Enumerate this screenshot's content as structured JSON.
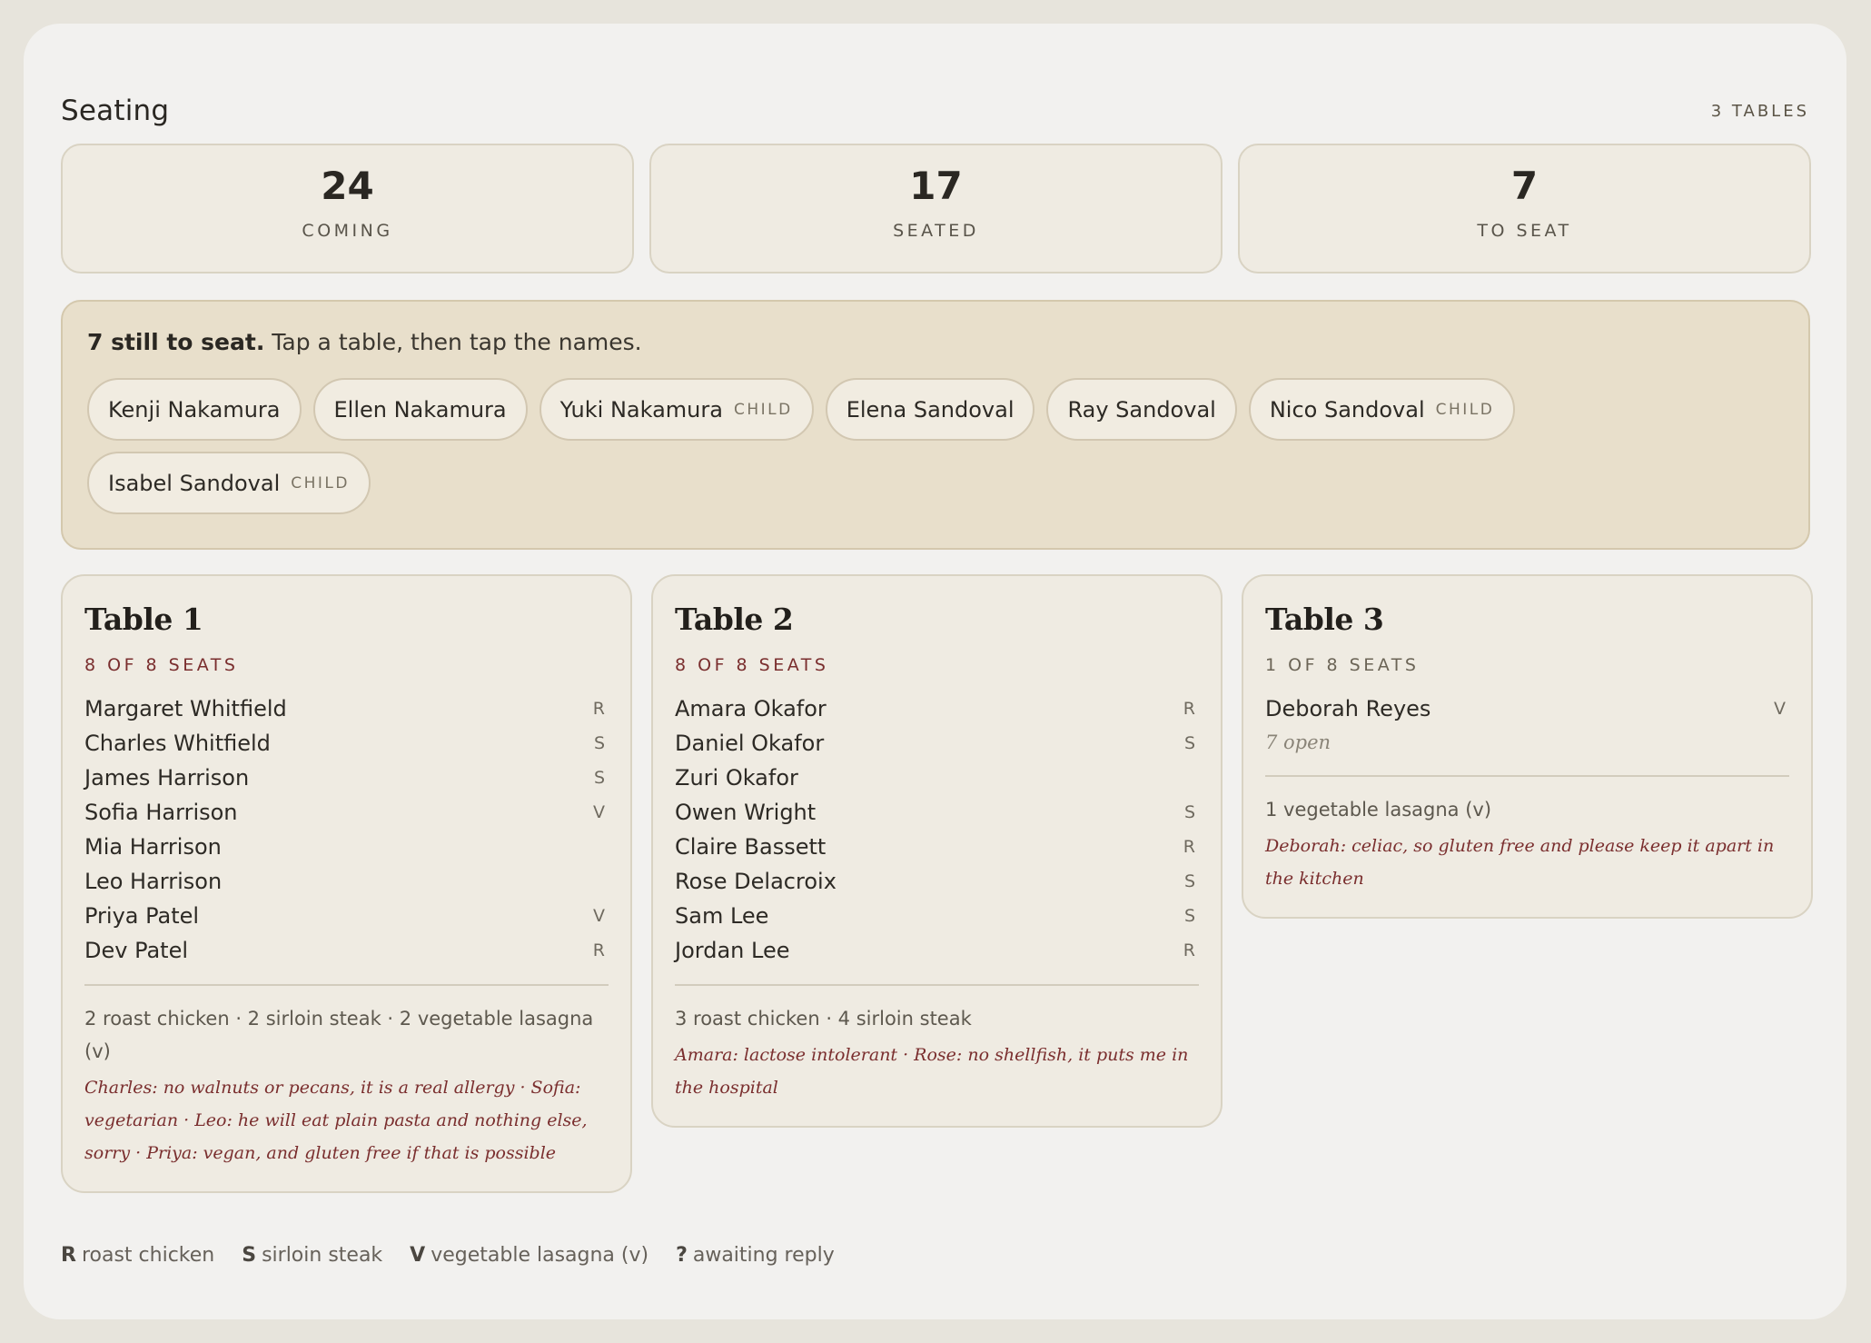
{
  "header": {
    "title": "Seating",
    "tables_count": "3 TABLES"
  },
  "stats": [
    {
      "value": "24",
      "label": "COMING"
    },
    {
      "value": "17",
      "label": "SEATED"
    },
    {
      "value": "7",
      "label": "TO SEAT"
    }
  ],
  "pending": {
    "bold": "7 still to seat.",
    "instruction": "Tap a table, then tap the names.",
    "guests": [
      {
        "name": "Kenji Nakamura",
        "tag": ""
      },
      {
        "name": "Ellen Nakamura",
        "tag": ""
      },
      {
        "name": "Yuki Nakamura",
        "tag": "CHILD"
      },
      {
        "name": "Elena Sandoval",
        "tag": ""
      },
      {
        "name": "Ray Sandoval",
        "tag": ""
      },
      {
        "name": "Nico Sandoval",
        "tag": "CHILD"
      },
      {
        "name": "Isabel Sandoval",
        "tag": "CHILD"
      }
    ]
  },
  "tables": [
    {
      "name": "Table 1",
      "seats": "8 OF 8 SEATS",
      "guests": [
        {
          "name": "Margaret Whitfield",
          "meal": "R"
        },
        {
          "name": "Charles Whitfield",
          "meal": "S"
        },
        {
          "name": "James Harrison",
          "meal": "S"
        },
        {
          "name": "Sofia Harrison",
          "meal": "V"
        },
        {
          "name": "Mia Harrison",
          "meal": ""
        },
        {
          "name": "Leo Harrison",
          "meal": ""
        },
        {
          "name": "Priya Patel",
          "meal": "V"
        },
        {
          "name": "Dev Patel",
          "meal": "R"
        }
      ],
      "open": "",
      "summary": "2 roast chicken · 2 sirloin steak · 2 vegetable lasagna (v)",
      "notes": "Charles: no walnuts or pecans, it is a real allergy · Sofia: vegetarian · Leo: he will eat plain pasta and nothing else, sorry · Priya: vegan, and gluten free if that is possible"
    },
    {
      "name": "Table 2",
      "seats": "8 OF 8 SEATS",
      "guests": [
        {
          "name": "Amara Okafor",
          "meal": "R"
        },
        {
          "name": "Daniel Okafor",
          "meal": "S"
        },
        {
          "name": "Zuri Okafor",
          "meal": ""
        },
        {
          "name": "Owen Wright",
          "meal": "S"
        },
        {
          "name": "Claire Bassett",
          "meal": "R"
        },
        {
          "name": "Rose Delacroix",
          "meal": "S"
        },
        {
          "name": "Sam Lee",
          "meal": "S"
        },
        {
          "name": "Jordan Lee",
          "meal": "R"
        }
      ],
      "open": "",
      "summary": "3 roast chicken · 4 sirloin steak",
      "notes": "Amara: lactose intolerant · Rose: no shellfish, it puts me in the hospital"
    },
    {
      "name": "Table 3",
      "seats": "1 OF 8 SEATS",
      "guests": [
        {
          "name": "Deborah Reyes",
          "meal": "V"
        }
      ],
      "open": "7 open",
      "summary": "1 vegetable lasagna (v)",
      "notes": "Deborah: celiac, so gluten free and please keep it apart in the kitchen"
    }
  ],
  "legend": [
    {
      "key": "R",
      "label": "roast chicken"
    },
    {
      "key": "S",
      "label": "sirloin steak"
    },
    {
      "key": "V",
      "label": "vegetable lasagna (v)"
    },
    {
      "key": "?",
      "label": "awaiting reply"
    }
  ]
}
